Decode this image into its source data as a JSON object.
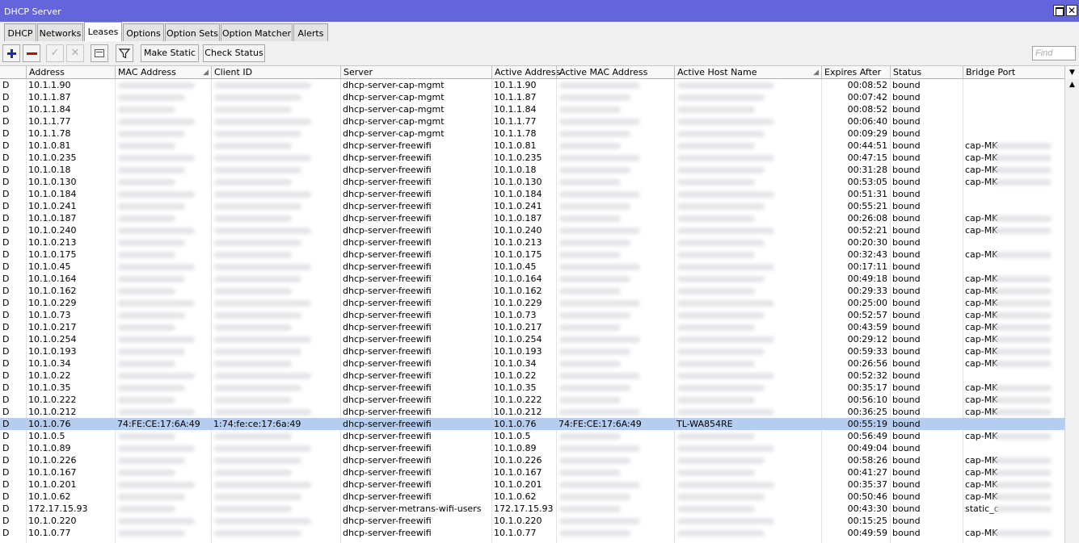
{
  "window": {
    "title": "DHCP Server"
  },
  "tabs": [
    {
      "label": "DHCP",
      "active": false
    },
    {
      "label": "Networks",
      "active": false
    },
    {
      "label": "Leases",
      "active": true
    },
    {
      "label": "Options",
      "active": false
    },
    {
      "label": "Option Sets",
      "active": false
    },
    {
      "label": "Option Matcher",
      "active": false
    },
    {
      "label": "Alerts",
      "active": false
    }
  ],
  "toolbar": {
    "make_static_label": "Make Static",
    "check_status_label": "Check Status",
    "find_placeholder": "Find"
  },
  "columns": [
    "Address",
    "MAC Address",
    "Client ID",
    "Server",
    "Active Address",
    "Active MAC Address",
    "Active Host Name",
    "Expires After",
    "Status",
    "Bridge Port"
  ],
  "rows": [
    {
      "flag": "D",
      "address": "10.1.1.90",
      "mac": "",
      "client_id": "",
      "server": "dhcp-server-cap-mgmt",
      "active_address": "10.1.1.90",
      "active_mac": "",
      "host": "",
      "expires": "00:08:52",
      "status": "bound",
      "bridge_port": ""
    },
    {
      "flag": "D",
      "address": "10.1.1.87",
      "mac": "",
      "client_id": "",
      "server": "dhcp-server-cap-mgmt",
      "active_address": "10.1.1.87",
      "active_mac": "",
      "host": "",
      "expires": "00:07:42",
      "status": "bound",
      "bridge_port": ""
    },
    {
      "flag": "D",
      "address": "10.1.1.84",
      "mac": "",
      "client_id": "",
      "server": "dhcp-server-cap-mgmt",
      "active_address": "10.1.1.84",
      "active_mac": "",
      "host": "",
      "expires": "00:08:52",
      "status": "bound",
      "bridge_port": ""
    },
    {
      "flag": "D",
      "address": "10.1.1.77",
      "mac": "",
      "client_id": "",
      "server": "dhcp-server-cap-mgmt",
      "active_address": "10.1.1.77",
      "active_mac": "",
      "host": "",
      "expires": "00:06:40",
      "status": "bound",
      "bridge_port": ""
    },
    {
      "flag": "D",
      "address": "10.1.1.78",
      "mac": "",
      "client_id": "",
      "server": "dhcp-server-cap-mgmt",
      "active_address": "10.1.1.78",
      "active_mac": "",
      "host": "",
      "expires": "00:09:29",
      "status": "bound",
      "bridge_port": ""
    },
    {
      "flag": "D",
      "address": "10.1.0.81",
      "mac": "",
      "client_id": "",
      "server": "dhcp-server-freewifi",
      "active_address": "10.1.0.81",
      "active_mac": "",
      "host": "",
      "expires": "00:44:51",
      "status": "bound",
      "bridge_port": "cap-MK-"
    },
    {
      "flag": "D",
      "address": "10.1.0.235",
      "mac": "",
      "client_id": "",
      "server": "dhcp-server-freewifi",
      "active_address": "10.1.0.235",
      "active_mac": "",
      "host": "",
      "expires": "00:47:15",
      "status": "bound",
      "bridge_port": "cap-MK-"
    },
    {
      "flag": "D",
      "address": "10.1.0.18",
      "mac": "",
      "client_id": "",
      "server": "dhcp-server-freewifi",
      "active_address": "10.1.0.18",
      "active_mac": "",
      "host": "",
      "expires": "00:31:28",
      "status": "bound",
      "bridge_port": "cap-MK-"
    },
    {
      "flag": "D",
      "address": "10.1.0.130",
      "mac": "",
      "client_id": "",
      "server": "dhcp-server-freewifi",
      "active_address": "10.1.0.130",
      "active_mac": "",
      "host": "",
      "expires": "00:53:05",
      "status": "bound",
      "bridge_port": "cap-MK-"
    },
    {
      "flag": "D",
      "address": "10.1.0.184",
      "mac": "",
      "client_id": "",
      "server": "dhcp-server-freewifi",
      "active_address": "10.1.0.184",
      "active_mac": "",
      "host": "",
      "expires": "00:51:31",
      "status": "bound",
      "bridge_port": ""
    },
    {
      "flag": "D",
      "address": "10.1.0.241",
      "mac": "",
      "client_id": "",
      "server": "dhcp-server-freewifi",
      "active_address": "10.1.0.241",
      "active_mac": "",
      "host": "",
      "expires": "00:55:21",
      "status": "bound",
      "bridge_port": ""
    },
    {
      "flag": "D",
      "address": "10.1.0.187",
      "mac": "",
      "client_id": "",
      "server": "dhcp-server-freewifi",
      "active_address": "10.1.0.187",
      "active_mac": "",
      "host": "",
      "expires": "00:26:08",
      "status": "bound",
      "bridge_port": "cap-MK-"
    },
    {
      "flag": "D",
      "address": "10.1.0.240",
      "mac": "",
      "client_id": "",
      "server": "dhcp-server-freewifi",
      "active_address": "10.1.0.240",
      "active_mac": "",
      "host": "",
      "expires": "00:52:21",
      "status": "bound",
      "bridge_port": "cap-MK-"
    },
    {
      "flag": "D",
      "address": "10.1.0.213",
      "mac": "",
      "client_id": "",
      "server": "dhcp-server-freewifi",
      "active_address": "10.1.0.213",
      "active_mac": "",
      "host": "",
      "expires": "00:20:30",
      "status": "bound",
      "bridge_port": ""
    },
    {
      "flag": "D",
      "address": "10.1.0.175",
      "mac": "",
      "client_id": "",
      "server": "dhcp-server-freewifi",
      "active_address": "10.1.0.175",
      "active_mac": "",
      "host": "",
      "expires": "00:32:43",
      "status": "bound",
      "bridge_port": "cap-MK-"
    },
    {
      "flag": "D",
      "address": "10.1.0.45",
      "mac": "",
      "client_id": "",
      "server": "dhcp-server-freewifi",
      "active_address": "10.1.0.45",
      "active_mac": "",
      "host": "",
      "expires": "00:17:11",
      "status": "bound",
      "bridge_port": ""
    },
    {
      "flag": "D",
      "address": "10.1.0.164",
      "mac": "",
      "client_id": "",
      "server": "dhcp-server-freewifi",
      "active_address": "10.1.0.164",
      "active_mac": "",
      "host": "",
      "expires": "00:49:18",
      "status": "bound",
      "bridge_port": "cap-MK-"
    },
    {
      "flag": "D",
      "address": "10.1.0.162",
      "mac": "",
      "client_id": "",
      "server": "dhcp-server-freewifi",
      "active_address": "10.1.0.162",
      "active_mac": "",
      "host": "",
      "expires": "00:29:33",
      "status": "bound",
      "bridge_port": "cap-MK-"
    },
    {
      "flag": "D",
      "address": "10.1.0.229",
      "mac": "",
      "client_id": "",
      "server": "dhcp-server-freewifi",
      "active_address": "10.1.0.229",
      "active_mac": "",
      "host": "",
      "expires": "00:25:00",
      "status": "bound",
      "bridge_port": "cap-MK-"
    },
    {
      "flag": "D",
      "address": "10.1.0.73",
      "mac": "",
      "client_id": "",
      "server": "dhcp-server-freewifi",
      "active_address": "10.1.0.73",
      "active_mac": "",
      "host": "",
      "expires": "00:52:57",
      "status": "bound",
      "bridge_port": "cap-MK-"
    },
    {
      "flag": "D",
      "address": "10.1.0.217",
      "mac": "",
      "client_id": "",
      "server": "dhcp-server-freewifi",
      "active_address": "10.1.0.217",
      "active_mac": "",
      "host": "",
      "expires": "00:43:59",
      "status": "bound",
      "bridge_port": "cap-MK-"
    },
    {
      "flag": "D",
      "address": "10.1.0.254",
      "mac": "",
      "client_id": "",
      "server": "dhcp-server-freewifi",
      "active_address": "10.1.0.254",
      "active_mac": "",
      "host": "",
      "expires": "00:29:12",
      "status": "bound",
      "bridge_port": "cap-MK-"
    },
    {
      "flag": "D",
      "address": "10.1.0.193",
      "mac": "",
      "client_id": "",
      "server": "dhcp-server-freewifi",
      "active_address": "10.1.0.193",
      "active_mac": "",
      "host": "",
      "expires": "00:59:33",
      "status": "bound",
      "bridge_port": "cap-MK-"
    },
    {
      "flag": "D",
      "address": "10.1.0.34",
      "mac": "",
      "client_id": "",
      "server": "dhcp-server-freewifi",
      "active_address": "10.1.0.34",
      "active_mac": "",
      "host": "",
      "expires": "00:26:56",
      "status": "bound",
      "bridge_port": "cap-MK-"
    },
    {
      "flag": "D",
      "address": "10.1.0.22",
      "mac": "",
      "client_id": "",
      "server": "dhcp-server-freewifi",
      "active_address": "10.1.0.22",
      "active_mac": "",
      "host": "",
      "expires": "00:52:32",
      "status": "bound",
      "bridge_port": ""
    },
    {
      "flag": "D",
      "address": "10.1.0.35",
      "mac": "",
      "client_id": "",
      "server": "dhcp-server-freewifi",
      "active_address": "10.1.0.35",
      "active_mac": "",
      "host": "",
      "expires": "00:35:17",
      "status": "bound",
      "bridge_port": "cap-MK-"
    },
    {
      "flag": "D",
      "address": "10.1.0.222",
      "mac": "",
      "client_id": "",
      "server": "dhcp-server-freewifi",
      "active_address": "10.1.0.222",
      "active_mac": "",
      "host": "",
      "expires": "00:56:10",
      "status": "bound",
      "bridge_port": "cap-MK-"
    },
    {
      "flag": "D",
      "address": "10.1.0.212",
      "mac": "",
      "client_id": "",
      "server": "dhcp-server-freewifi",
      "active_address": "10.1.0.212",
      "active_mac": "",
      "host": "",
      "expires": "00:36:25",
      "status": "bound",
      "bridge_port": "cap-MK-"
    },
    {
      "flag": "D",
      "address": "10.1.0.76",
      "mac": "74:FE:CE:17:6A:49",
      "client_id": "1:74:fe:ce:17:6a:49",
      "server": "dhcp-server-freewifi",
      "active_address": "10.1.0.76",
      "active_mac": "74:FE:CE:17:6A:49",
      "host": "TL-WA854RE",
      "expires": "00:55:19",
      "status": "bound",
      "bridge_port": "",
      "selected": true
    },
    {
      "flag": "D",
      "address": "10.1.0.5",
      "mac": "",
      "client_id": "",
      "server": "dhcp-server-freewifi",
      "active_address": "10.1.0.5",
      "active_mac": "",
      "host": "",
      "expires": "00:56:49",
      "status": "bound",
      "bridge_port": "cap-MK-"
    },
    {
      "flag": "D",
      "address": "10.1.0.89",
      "mac": "",
      "client_id": "",
      "server": "dhcp-server-freewifi",
      "active_address": "10.1.0.89",
      "active_mac": "",
      "host": "",
      "expires": "00:49:04",
      "status": "bound",
      "bridge_port": ""
    },
    {
      "flag": "D",
      "address": "10.1.0.226",
      "mac": "",
      "client_id": "",
      "server": "dhcp-server-freewifi",
      "active_address": "10.1.0.226",
      "active_mac": "",
      "host": "",
      "expires": "00:58:26",
      "status": "bound",
      "bridge_port": "cap-MK-"
    },
    {
      "flag": "D",
      "address": "10.1.0.167",
      "mac": "",
      "client_id": "",
      "server": "dhcp-server-freewifi",
      "active_address": "10.1.0.167",
      "active_mac": "",
      "host": "",
      "expires": "00:41:27",
      "status": "bound",
      "bridge_port": "cap-MK-"
    },
    {
      "flag": "D",
      "address": "10.1.0.201",
      "mac": "",
      "client_id": "",
      "server": "dhcp-server-freewifi",
      "active_address": "10.1.0.201",
      "active_mac": "",
      "host": "",
      "expires": "00:35:37",
      "status": "bound",
      "bridge_port": "cap-MK-"
    },
    {
      "flag": "D",
      "address": "10.1.0.62",
      "mac": "",
      "client_id": "",
      "server": "dhcp-server-freewifi",
      "active_address": "10.1.0.62",
      "active_mac": "",
      "host": "",
      "expires": "00:50:46",
      "status": "bound",
      "bridge_port": "cap-MK-"
    },
    {
      "flag": "D",
      "address": "172.17.15.93",
      "mac": "",
      "client_id": "",
      "server": "dhcp-server-metrans-wifi-users",
      "active_address": "172.17.15.93",
      "active_mac": "",
      "host": "",
      "expires": "00:43:30",
      "status": "bound",
      "bridge_port": "static_c"
    },
    {
      "flag": "D",
      "address": "10.1.0.220",
      "mac": "",
      "client_id": "",
      "server": "dhcp-server-freewifi",
      "active_address": "10.1.0.220",
      "active_mac": "",
      "host": "",
      "expires": "00:15:25",
      "status": "bound",
      "bridge_port": ""
    },
    {
      "flag": "D",
      "address": "10.1.0.77",
      "mac": "",
      "client_id": "",
      "server": "dhcp-server-freewifi",
      "active_address": "10.1.0.77",
      "active_mac": "",
      "host": "",
      "expires": "00:49:59",
      "status": "bound",
      "bridge_port": "cap-MK-"
    }
  ]
}
